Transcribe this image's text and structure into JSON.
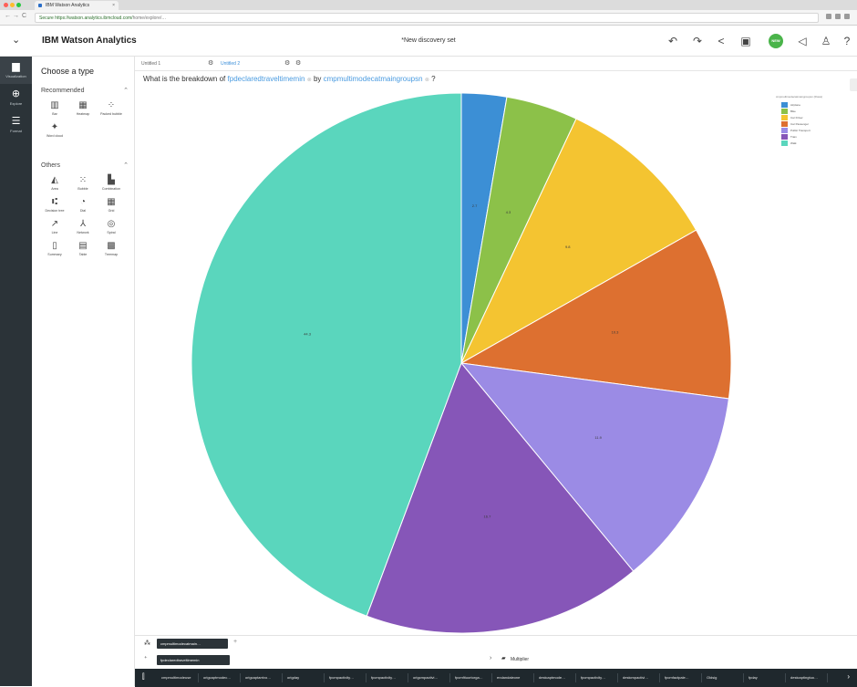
{
  "browser": {
    "tab_title": "IBM Watson Analytics",
    "tab_close": "×",
    "url_secure": "Secure",
    "url_text": "https://watson.analytics.ibmcloud.com/",
    "url_rest": "home/explore/…",
    "nav_back": "←",
    "nav_forward": "→",
    "nav_reload": "C"
  },
  "header": {
    "menu_icon": "⌄",
    "app_title": "IBM Watson Analytics",
    "discovery_title": "*New discovery set",
    "new_badge": "NEW"
  },
  "rail": {
    "items": [
      {
        "icon": "bar-chart-icon",
        "glyph": "▆",
        "label": "Visualization"
      },
      {
        "icon": "explore-icon",
        "glyph": "⊕",
        "label": "Explore"
      },
      {
        "icon": "format-icon",
        "glyph": "☰",
        "label": "Format"
      }
    ]
  },
  "panel": {
    "title": "Choose a type",
    "recommended_label": "Recommended",
    "recommended": [
      {
        "label": "Bar",
        "glyph": "▥"
      },
      {
        "label": "Heatmap",
        "glyph": "▦"
      },
      {
        "label": "Packed bubble",
        "glyph": "⁘"
      },
      {
        "label": "Word cloud",
        "glyph": "✦"
      }
    ],
    "others_label": "Others",
    "others": [
      {
        "label": "Area",
        "glyph": "◭"
      },
      {
        "label": "Bubble",
        "glyph": "⁙"
      },
      {
        "label": "Combination",
        "glyph": "▙"
      },
      {
        "label": "Decision tree",
        "glyph": "⑆"
      },
      {
        "label": "Dial",
        "glyph": "◔"
      },
      {
        "label": "Grid",
        "glyph": "▦"
      },
      {
        "label": "Line",
        "glyph": "↗"
      },
      {
        "label": "Network",
        "glyph": "⅄"
      },
      {
        "label": "Spiral",
        "glyph": "◎"
      },
      {
        "label": "Summary",
        "glyph": "▯"
      },
      {
        "label": "Table",
        "glyph": "▤"
      },
      {
        "label": "Treemap",
        "glyph": "▩"
      }
    ]
  },
  "tabs": [
    {
      "label": "Untitled 1"
    },
    {
      "label": "Untitled 2"
    }
  ],
  "question": {
    "prefix": "What is the breakdown of",
    "token1": "fpdeclaredtraveltimemin",
    "middle": "by",
    "token2": "cmpmultimodecatmaingroupsn",
    "suffix": "?",
    "remove_glyph": "⊗"
  },
  "legend": {
    "title": "cmpmultimodecatmaingroupsn (Rows)",
    "items": [
      {
        "label": "Airplane",
        "color": "#3c8fd5"
      },
      {
        "label": "Bike",
        "color": "#8cc149"
      },
      {
        "label": "Car Driver",
        "color": "#f4c431"
      },
      {
        "label": "Car Passenger",
        "color": "#dd7030"
      },
      {
        "label": "Public Transport",
        "color": "#9b8be5"
      },
      {
        "label": "Train",
        "color": "#8656b8"
      },
      {
        "label": "Walk",
        "color": "#5ad6bd"
      }
    ]
  },
  "chart_data": {
    "type": "pie",
    "categories": [
      "Airplane",
      "Bike",
      "Car Driver",
      "Car Passenger",
      "Public Transport",
      "Train",
      "Walk"
    ],
    "values": [
      2.7,
      4.3,
      9.8,
      10.3,
      11.9,
      16.7,
      44.3
    ],
    "labels": [
      "2.7",
      "4.3",
      "9.8",
      "10.3",
      "11.9",
      "16.7",
      "44.3"
    ],
    "colors": [
      "#3c8fd5",
      "#8cc149",
      "#f4c431",
      "#dd7030",
      "#9b8be5",
      "#8656b8",
      "#5ad6bd"
    ],
    "legend_position": "top-right"
  },
  "bottom": {
    "columns_pill": "cmpmultimodecatmain…",
    "size_pill": "fpdeclaredtraveltimemin",
    "multiplier": "Multiplier",
    "column_strip": [
      "cmpmultimodeuse",
      "origcaptmodec…",
      "origcaptarrivo…",
      "origday",
      "fpcmpactivity…",
      "fpcmpactivity…",
      "origcmpactivi…",
      "fpcmfituortorga…",
      "endandaleone",
      "destcaptmode…",
      "fpcmpactivity…",
      "destcmpactivi…",
      "fpcmfactpale…",
      "Oldsig",
      "fpday",
      "destcaptingtuo…"
    ]
  }
}
